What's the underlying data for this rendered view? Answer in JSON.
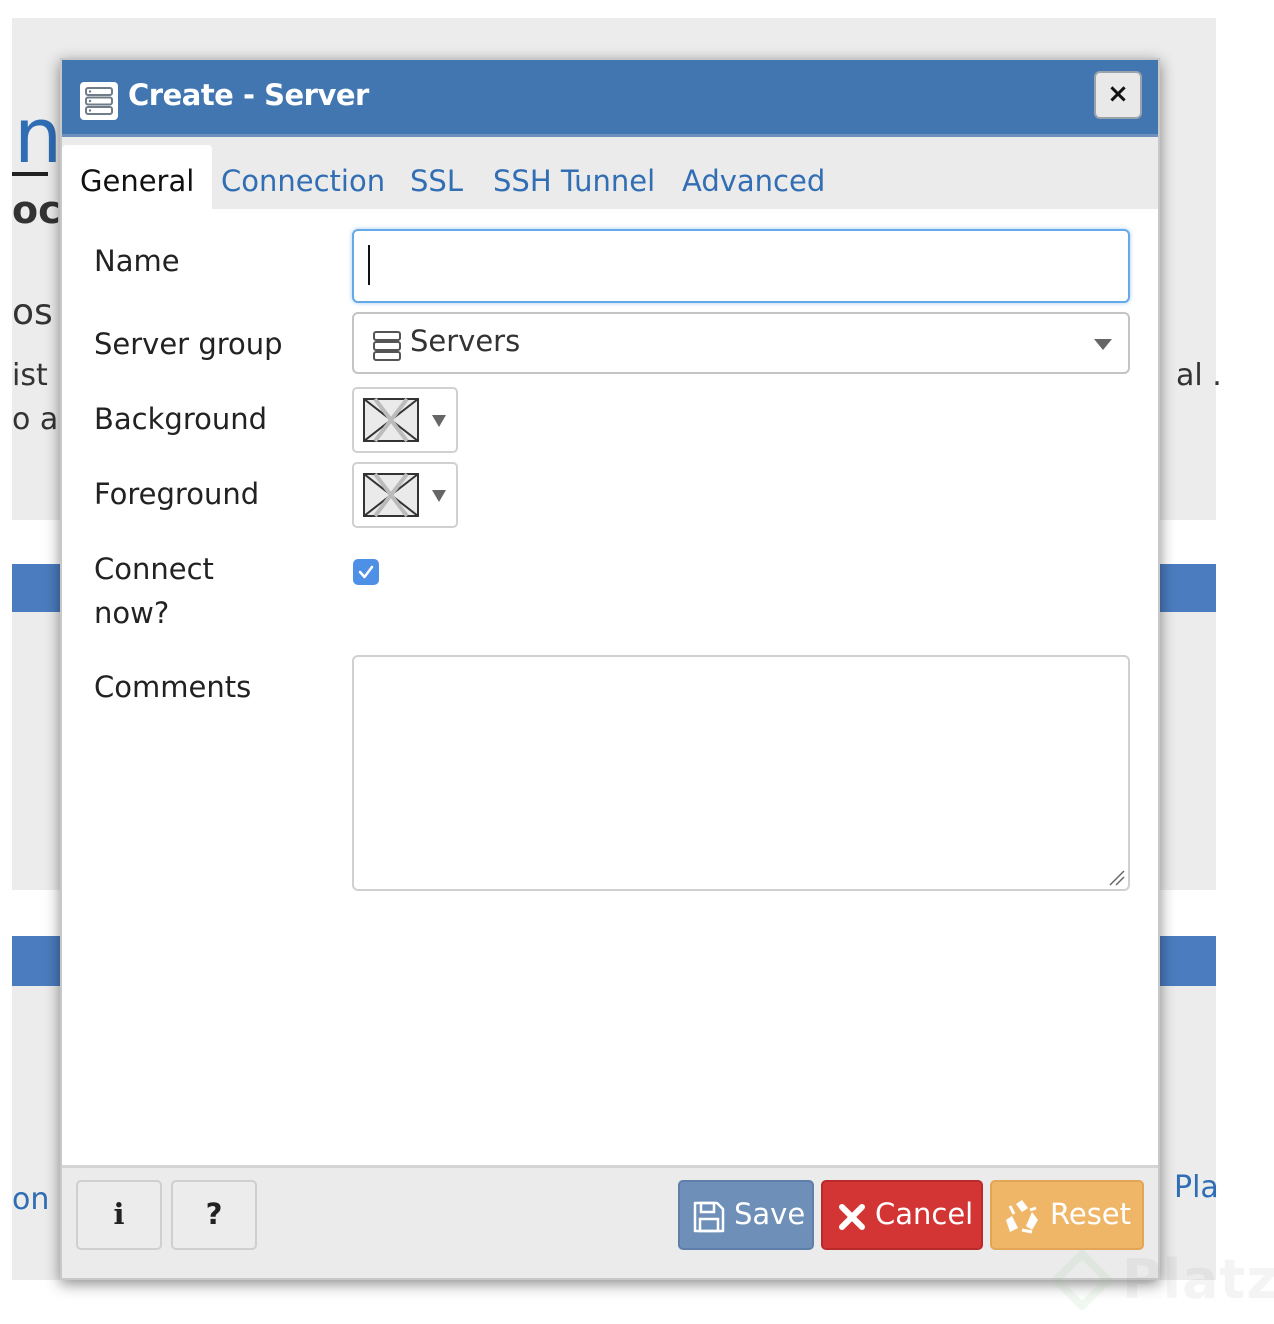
{
  "dialog": {
    "title": "Create - Server",
    "close_symbol": "×"
  },
  "tabs": [
    {
      "label": "General",
      "active": true
    },
    {
      "label": "Connection",
      "active": false
    },
    {
      "label": "SSL",
      "active": false
    },
    {
      "label": "SSH Tunnel",
      "active": false
    },
    {
      "label": "Advanced",
      "active": false
    }
  ],
  "form": {
    "name_label": "Name",
    "name_value": "",
    "server_group_label": "Server group",
    "server_group_value": "Servers",
    "background_label": "Background",
    "foreground_label": "Foreground",
    "connect_now_label_line1": "Connect",
    "connect_now_label_line2": "now?",
    "connect_now_checked": true,
    "comments_label": "Comments",
    "comments_value": ""
  },
  "footer": {
    "info_label": "i",
    "help_label": "?",
    "save_label": "Save",
    "cancel_label": "Cancel",
    "reset_label": "Reset"
  },
  "background_page": {
    "frag_1": "n",
    "frag_2": "oc",
    "frag_3": "os",
    "frag_4": "ist",
    "frag_5": "o a",
    "frag_6": "al .",
    "frag_7": "on",
    "frag_8": "Pla"
  },
  "watermark": "Platzi",
  "icons": {
    "title": "server-icon",
    "server_group": "server-group-icon",
    "save": "floppy-disk-icon",
    "cancel": "x-icon",
    "reset": "recycle-icon"
  },
  "colors": {
    "titlebar": "#4276b1",
    "tab_link": "#326eb3",
    "save": "#6e8fb8",
    "cancel": "#d33535",
    "reset": "#f0b668",
    "checkbox": "#4d90e6"
  }
}
